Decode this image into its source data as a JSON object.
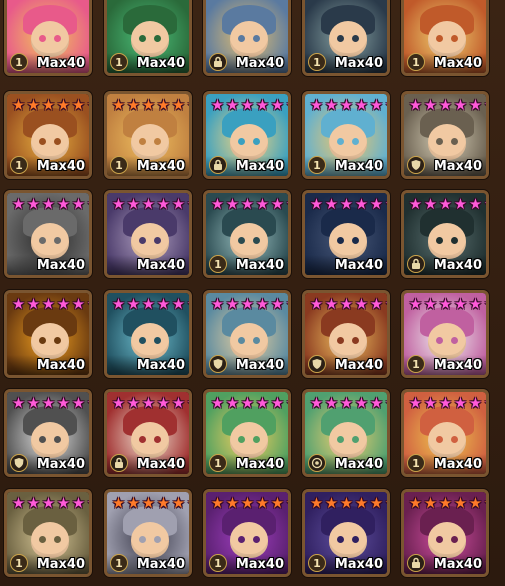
{
  "max_label": "Max40",
  "colors": {
    "pink_star": "#ff5ad9",
    "red_star": "#ff7a2a",
    "frame": "#7a5530",
    "background": "#2c1a0e"
  },
  "rows": [
    {
      "cells": [
        {
          "stars": "none",
          "count": 6,
          "badge": "1",
          "palette": [
            "#f2c75a",
            "#e85a8a"
          ]
        },
        {
          "stars": "none",
          "count": 6,
          "badge": "1",
          "palette": [
            "#4cc07a",
            "#2a6a3a"
          ]
        },
        {
          "stars": "none",
          "count": 6,
          "badge": "lock",
          "palette": [
            "#e6c070",
            "#5a7aa0"
          ]
        },
        {
          "stars": "none",
          "count": 6,
          "badge": "1",
          "palette": [
            "#8aa5a5",
            "#2a3a4a"
          ]
        },
        {
          "stars": "none",
          "count": 6,
          "badge": "1",
          "palette": [
            "#f0d070",
            "#c05a2a"
          ]
        }
      ]
    },
    {
      "cells": [
        {
          "stars": "red",
          "count": 6,
          "badge": "1",
          "palette": [
            "#e8b040",
            "#9a5020"
          ]
        },
        {
          "stars": "red",
          "count": 6,
          "badge": "1",
          "palette": [
            "#f0c060",
            "#c08040"
          ]
        },
        {
          "stars": "pink",
          "count": 6,
          "badge": "lock",
          "palette": [
            "#f6d680",
            "#3aa0c0"
          ]
        },
        {
          "stars": "pink",
          "count": 6,
          "badge": "1",
          "palette": [
            "#f2c86a",
            "#60b0d0"
          ]
        },
        {
          "stars": "pink",
          "count": 6,
          "badge": "shield",
          "palette": [
            "#d8d0b8",
            "#6a6050"
          ]
        }
      ]
    },
    {
      "cells": [
        {
          "stars": "pink",
          "count": 6,
          "badge": "",
          "palette": [
            "#2a2a2a",
            "#6a6a6a"
          ]
        },
        {
          "stars": "pink",
          "count": 6,
          "badge": "",
          "palette": [
            "#b0a0c0",
            "#4a3a6a"
          ]
        },
        {
          "stars": "pink",
          "count": 6,
          "badge": "1",
          "palette": [
            "#9ac0c0",
            "#2a4a50"
          ]
        },
        {
          "stars": "pink",
          "count": 6,
          "badge": "",
          "palette": [
            "#4a5a7a",
            "#1a2a4a"
          ]
        },
        {
          "stars": "pink",
          "count": 6,
          "badge": "lock",
          "palette": [
            "#5a7070",
            "#203030"
          ]
        }
      ]
    },
    {
      "cells": [
        {
          "stars": "pink",
          "count": 6,
          "badge": "",
          "palette": [
            "#f0a020",
            "#6a3a10"
          ]
        },
        {
          "stars": "pink",
          "count": 6,
          "badge": "",
          "palette": [
            "#70c0d0",
            "#205060"
          ]
        },
        {
          "stars": "pink",
          "count": 6,
          "badge": "shield",
          "palette": [
            "#e8d0a0",
            "#5a8aa0"
          ]
        },
        {
          "stars": "pink",
          "count": 6,
          "badge": "shield",
          "palette": [
            "#f0c060",
            "#8a3a20"
          ]
        },
        {
          "stars": "pink",
          "count": 6,
          "badge": "1",
          "palette": [
            "#f0f0f0",
            "#c060a0"
          ]
        }
      ]
    },
    {
      "cells": [
        {
          "stars": "pink",
          "count": 6,
          "badge": "shield",
          "palette": [
            "#e0e0e0",
            "#505050"
          ]
        },
        {
          "stars": "pink",
          "count": 6,
          "badge": "lock",
          "palette": [
            "#f0e0d0",
            "#a03030"
          ]
        },
        {
          "stars": "pink",
          "count": 6,
          "badge": "1",
          "palette": [
            "#f4d060",
            "#50a060"
          ]
        },
        {
          "stars": "pink",
          "count": 6,
          "badge": "rune",
          "palette": [
            "#f0d070",
            "#50a070"
          ]
        },
        {
          "stars": "pink",
          "count": 6,
          "badge": "1",
          "palette": [
            "#f0c850",
            "#d06040"
          ]
        }
      ]
    },
    {
      "cells": [
        {
          "stars": "pink",
          "count": 6,
          "badge": "1",
          "palette": [
            "#d8c898",
            "#6a6040"
          ]
        },
        {
          "stars": "red",
          "count": 6,
          "badge": "1",
          "palette": [
            "#3a3a4a",
            "#a0a0b0"
          ]
        },
        {
          "stars": "red",
          "count": 6,
          "badge": "1",
          "palette": [
            "#a040c0",
            "#5a2070"
          ]
        },
        {
          "stars": "red",
          "count": 6,
          "badge": "1",
          "palette": [
            "#6050a0",
            "#302060"
          ]
        },
        {
          "stars": "red",
          "count": 6,
          "badge": "lock",
          "palette": [
            "#d050a0",
            "#6a2050"
          ]
        }
      ]
    }
  ]
}
